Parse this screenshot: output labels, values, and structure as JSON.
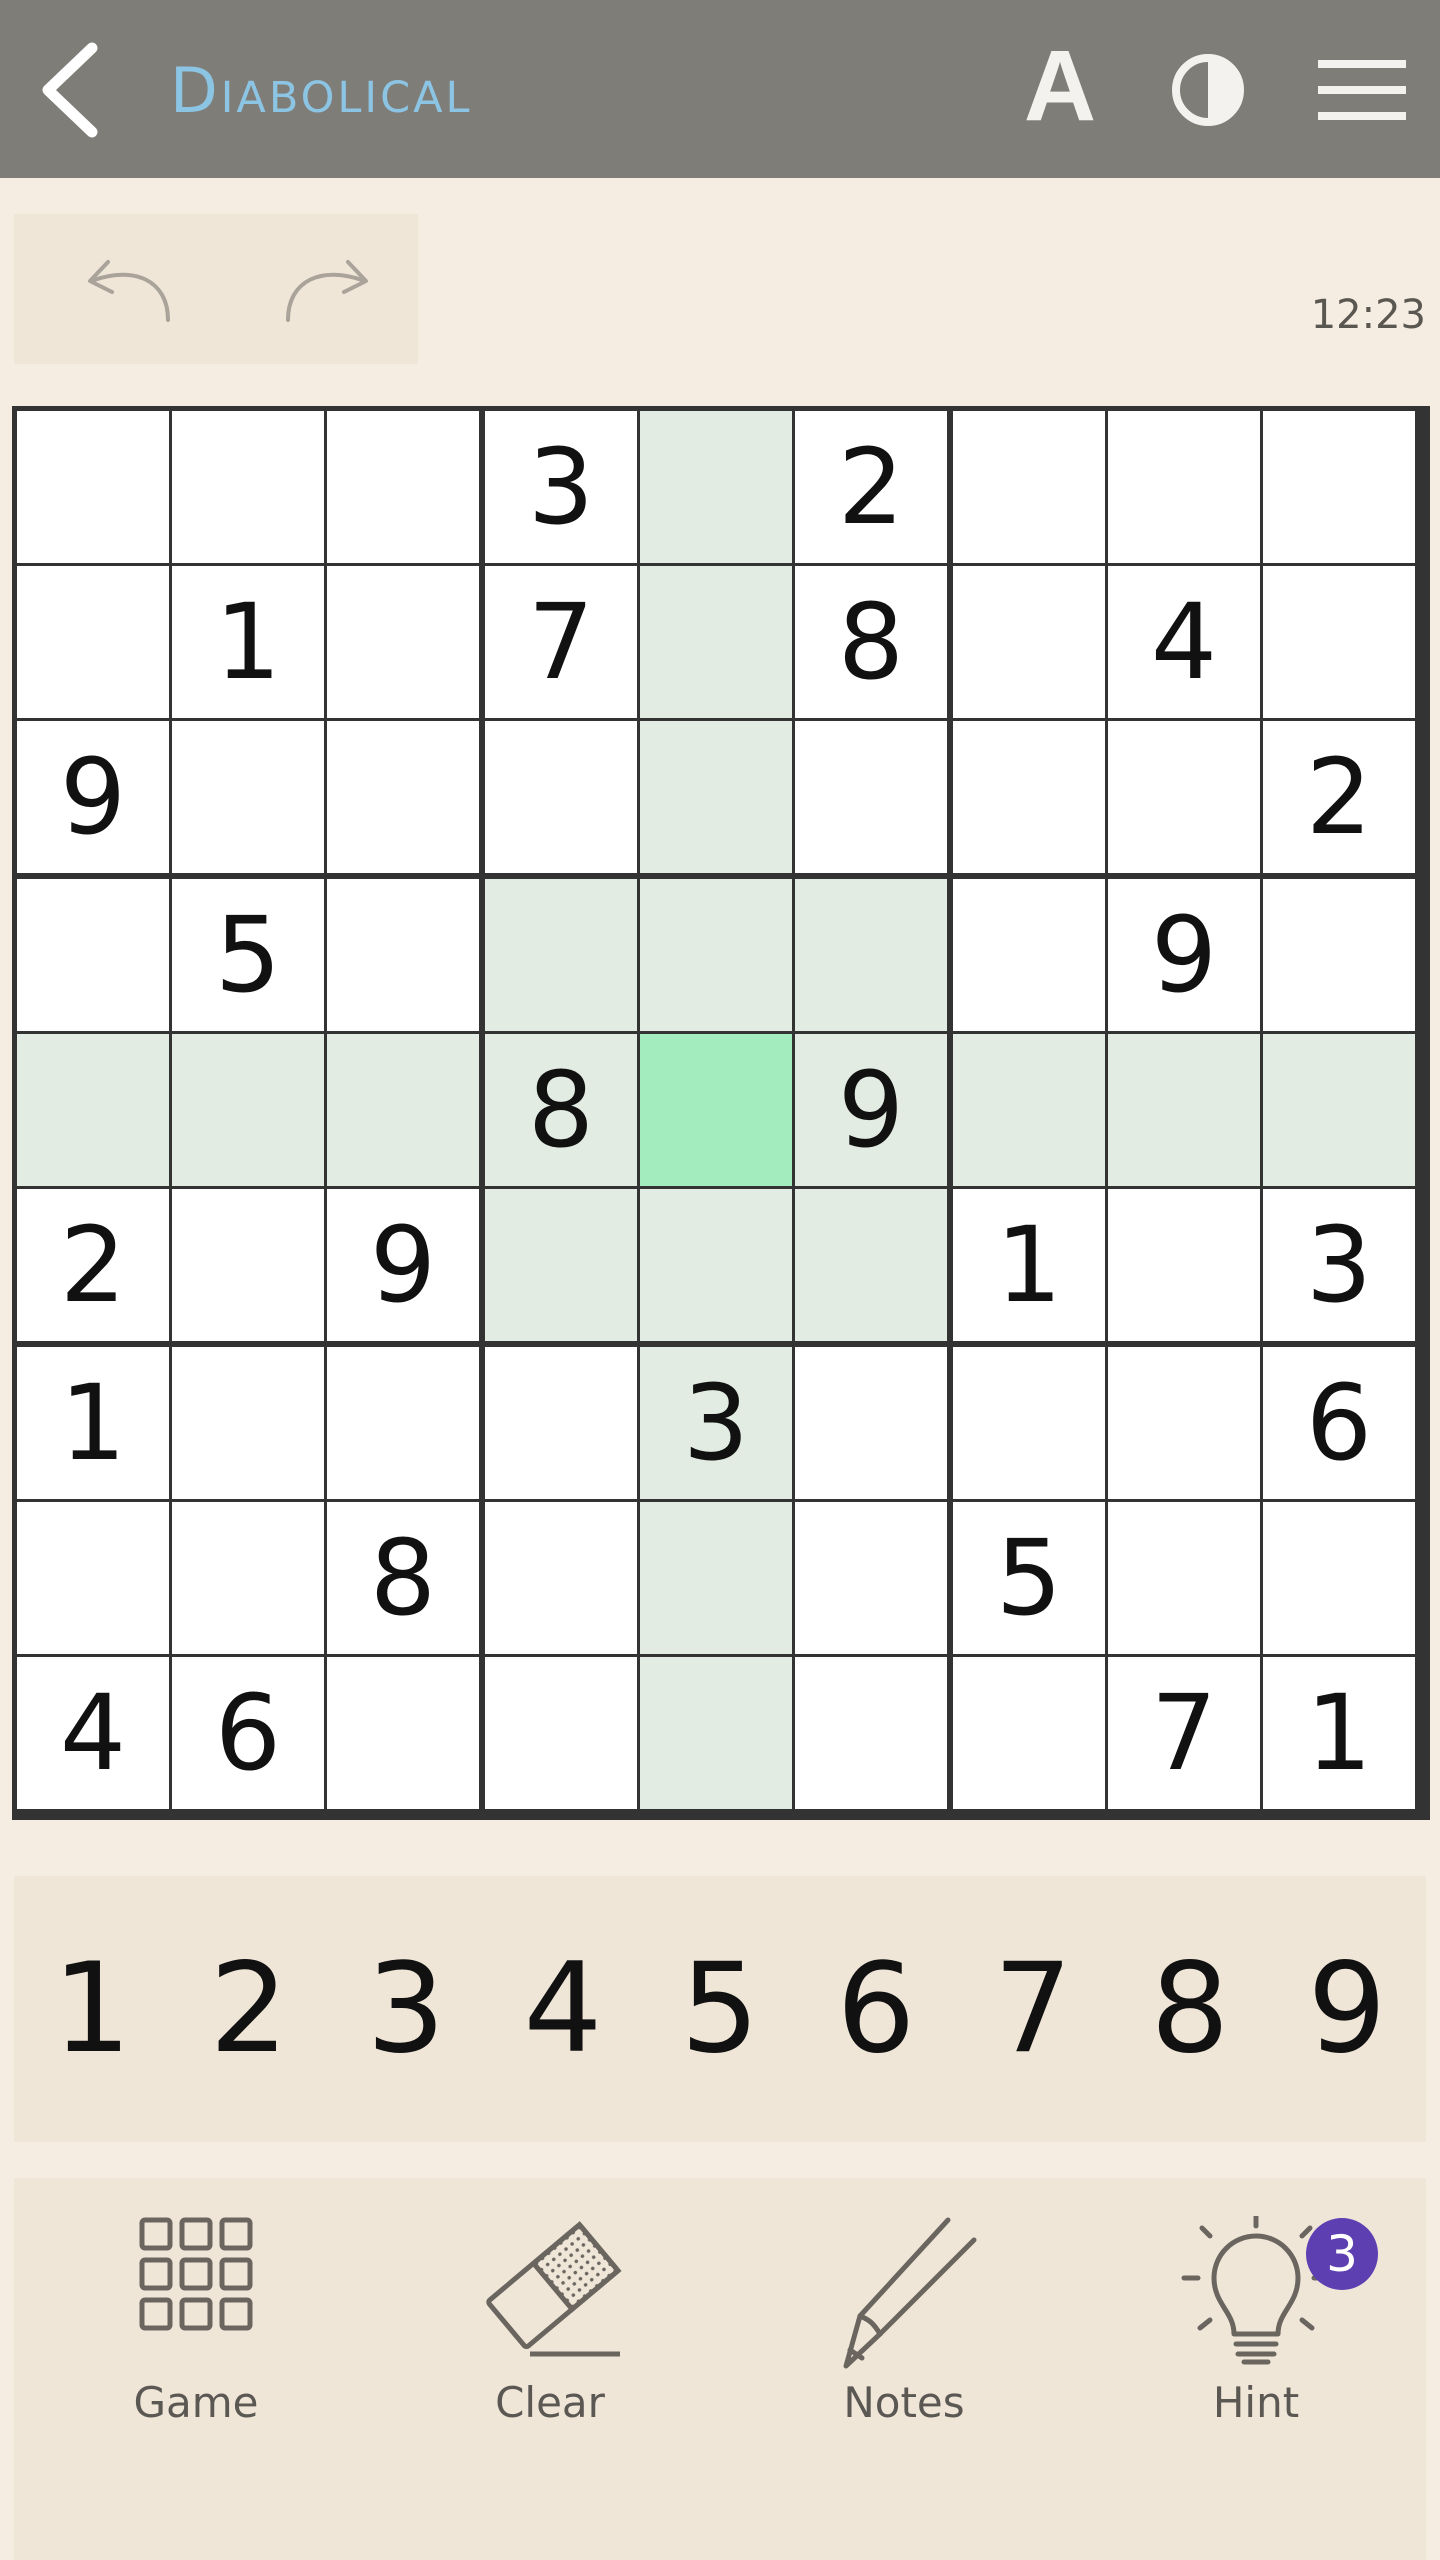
{
  "header": {
    "back_icon": "chevron-left-icon",
    "title": "Diabolical",
    "font_size_label": "A",
    "contrast_icon": "contrast-icon",
    "menu_icon": "hamburger-menu-icon"
  },
  "history": {
    "undo_icon": "undo-icon",
    "redo_icon": "redo-icon"
  },
  "timer": "12:23",
  "board": {
    "selected": {
      "row": 4,
      "col": 4
    },
    "rows": [
      [
        "",
        "",
        "",
        "3",
        "",
        "2",
        "",
        "",
        ""
      ],
      [
        "",
        "1",
        "",
        "7",
        "",
        "8",
        "",
        "4",
        ""
      ],
      [
        "9",
        "",
        "",
        "",
        "",
        "",
        "",
        "",
        "2"
      ],
      [
        "",
        "5",
        "",
        "",
        "",
        "",
        "",
        "9",
        ""
      ],
      [
        "",
        "",
        "",
        "8",
        "",
        "9",
        "",
        "",
        ""
      ],
      [
        "2",
        "",
        "9",
        "",
        "",
        "",
        "1",
        "",
        "3"
      ],
      [
        "1",
        "",
        "",
        "",
        "3",
        "",
        "",
        "",
        "6"
      ],
      [
        "",
        "",
        "8",
        "",
        "",
        "",
        "5",
        "",
        ""
      ],
      [
        "4",
        "6",
        "",
        "",
        "",
        "",
        "",
        "7",
        "1"
      ]
    ]
  },
  "numpad": [
    "1",
    "2",
    "3",
    "4",
    "5",
    "6",
    "7",
    "8",
    "9"
  ],
  "toolbar": {
    "game_label": "Game",
    "clear_label": "Clear",
    "notes_label": "Notes",
    "hint_label": "Hint",
    "hint_count": "3"
  },
  "colors": {
    "header_bg": "#7f7d78",
    "title": "#8cc4e3",
    "highlight": "#e2ece3",
    "selected": "#a3ecbd",
    "badge": "#5d3fb2"
  }
}
